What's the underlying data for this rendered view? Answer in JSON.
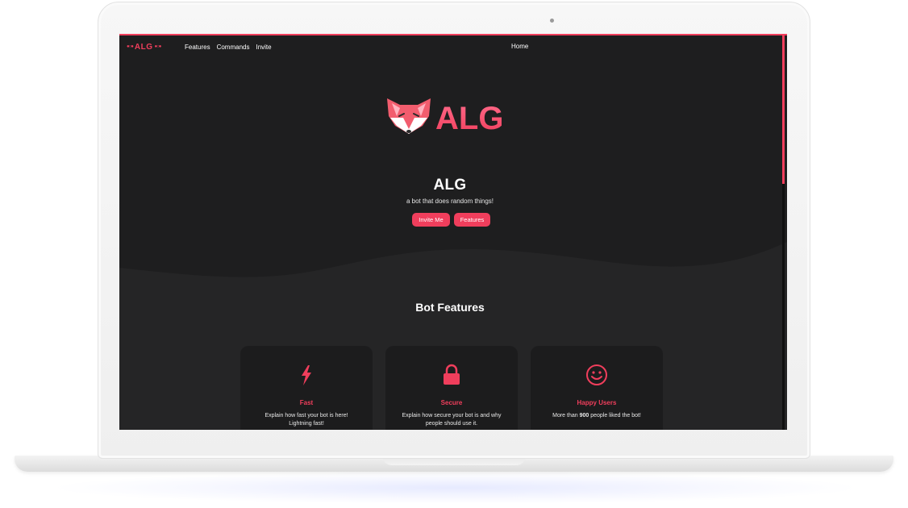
{
  "nav": {
    "logo_text": "ALG",
    "links": [
      "Features",
      "Commands",
      "Invite"
    ],
    "home": "Home"
  },
  "hero": {
    "logo_text": "ALG",
    "title": "ALG",
    "subtitle": "a bot that does random things!",
    "buttons": {
      "invite": "Invite Me",
      "features": "Features"
    }
  },
  "features": {
    "heading": "Bot Features",
    "cards": [
      {
        "icon": "lightning-icon",
        "title": "Fast",
        "desc": "Explain how fast your bot is here! Lightning fast!"
      },
      {
        "icon": "lock-icon",
        "title": "Secure",
        "desc": "Explain how secure your bot is and why people should use it."
      },
      {
        "icon": "smiley-icon",
        "title": "Happy Users",
        "desc_prefix": "More than ",
        "desc_bold": "900",
        "desc_suffix": " people liked the bot!"
      }
    ]
  },
  "colors": {
    "accent": "#f03e5c",
    "background": "#1e1e1f",
    "card": "#1c1c1d"
  }
}
